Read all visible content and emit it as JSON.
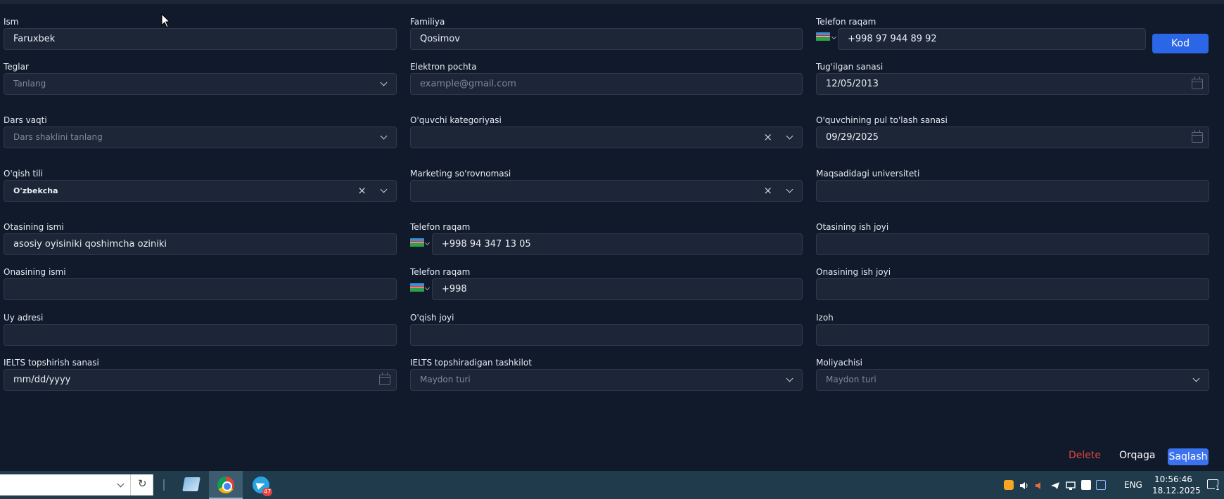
{
  "form": {
    "ism": {
      "label": "Ism",
      "value": "Faruxbek"
    },
    "familiya": {
      "label": "Familiya",
      "value": "Qosimov"
    },
    "telefon": {
      "label": "Telefon raqam",
      "value": "+998 97 944 89 92",
      "kod_button": "Kod"
    },
    "teglar": {
      "label": "Teglar",
      "placeholder": "Tanlang"
    },
    "email": {
      "label": "Elektron pochta",
      "placeholder": "example@gmail.com"
    },
    "tugilgan": {
      "label": "Tug'ilgan sanasi",
      "value": "12/05/2013"
    },
    "dars_vaqti": {
      "label": "Dars vaqti",
      "placeholder": "Dars shaklini tanlang"
    },
    "kategoriya": {
      "label": "O'quvchi kategoriyasi",
      "value": "",
      "clear": "×"
    },
    "pul_sanasi": {
      "label": "O'quvchining pul to'lash sanasi",
      "value": "09/29/2025"
    },
    "oqish_tili": {
      "label": "O'qish tili",
      "value": "O'zbekcha",
      "clear": "×"
    },
    "marketing": {
      "label": "Marketing so'rovnomasi",
      "value": "",
      "clear": "×"
    },
    "universitet": {
      "label": "Maqsadidagi universiteti",
      "value": ""
    },
    "otasi": {
      "label": "Otasining ismi",
      "value": "asosiy oyisiniki qoshimcha oziniki"
    },
    "ota_tel": {
      "label": "Telefon raqam",
      "value": "+998 94 347 13 05"
    },
    "ota_ish": {
      "label": "Otasining ish joyi",
      "value": ""
    },
    "onasi": {
      "label": "Onasining ismi",
      "value": ""
    },
    "ona_tel": {
      "label": "Telefon raqam",
      "value": "+998"
    },
    "ona_ish": {
      "label": "Onasining ish joyi",
      "value": ""
    },
    "uy": {
      "label": "Uy adresi",
      "value": ""
    },
    "oqish_joyi": {
      "label": "O'qish joyi",
      "value": ""
    },
    "izoh": {
      "label": "Izoh",
      "value": ""
    },
    "ielts_sana": {
      "label": "IELTS topshirish sanasi",
      "placeholder": "mm/dd/yyyy"
    },
    "ielts_tashkilot": {
      "label": "IELTS topshiradigan tashkilot",
      "placeholder": "Maydon turi"
    },
    "moliyachi": {
      "label": "Moliyachisi",
      "placeholder": "Maydon turi"
    }
  },
  "actions": {
    "delete": "Delete",
    "back": "Orqaga",
    "save": "Saqlash"
  },
  "taskbar": {
    "refresh_icon": "↻",
    "telegram_badge": "47",
    "language": "ENG",
    "time": "10:56:46",
    "date": "18.12.2025",
    "notification_count": "1"
  },
  "colors": {
    "primary": "#2b66e6",
    "delete": "#e0473a",
    "background": "#111a2b",
    "field": "#1c2637"
  }
}
